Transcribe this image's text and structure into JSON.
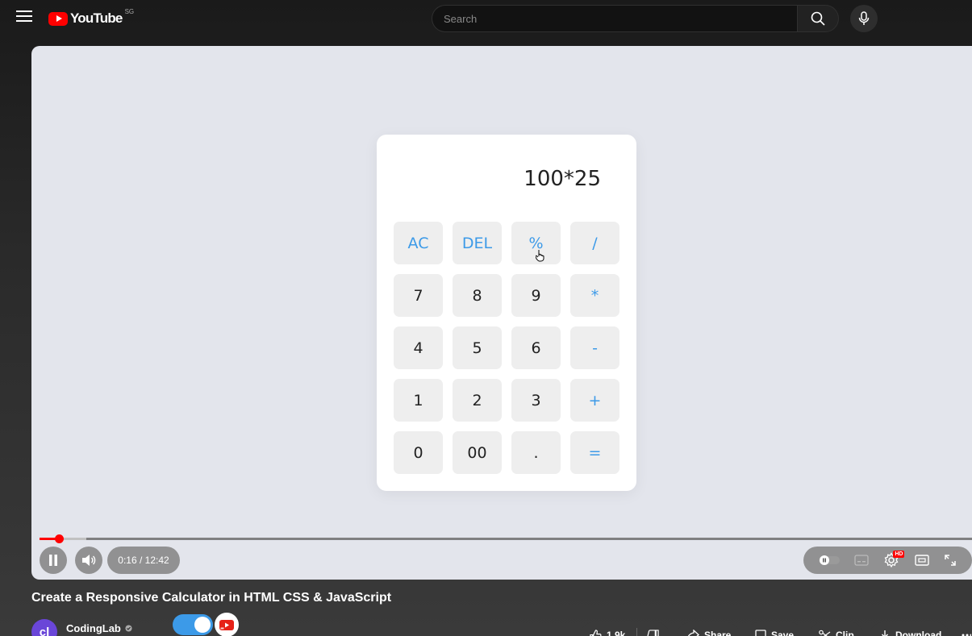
{
  "topbar": {
    "logo_text": "YouTube",
    "region": "SG",
    "search_placeholder": "Search"
  },
  "calculator": {
    "display": "100*25",
    "keys": [
      {
        "label": "AC",
        "kind": "op"
      },
      {
        "label": "DEL",
        "kind": "op"
      },
      {
        "label": "%",
        "kind": "op"
      },
      {
        "label": "/",
        "kind": "op"
      },
      {
        "label": "7",
        "kind": "num"
      },
      {
        "label": "8",
        "kind": "num"
      },
      {
        "label": "9",
        "kind": "num"
      },
      {
        "label": "*",
        "kind": "op"
      },
      {
        "label": "4",
        "kind": "num"
      },
      {
        "label": "5",
        "kind": "num"
      },
      {
        "label": "6",
        "kind": "num"
      },
      {
        "label": "-",
        "kind": "op"
      },
      {
        "label": "1",
        "kind": "num"
      },
      {
        "label": "2",
        "kind": "num"
      },
      {
        "label": "3",
        "kind": "num"
      },
      {
        "label": "+",
        "kind": "op"
      },
      {
        "label": "0",
        "kind": "num"
      },
      {
        "label": "00",
        "kind": "num"
      },
      {
        "label": ".",
        "kind": "num"
      },
      {
        "label": "=",
        "kind": "op"
      }
    ],
    "accent_color": "#3c9ae8"
  },
  "player": {
    "time": "0:16 / 12:42",
    "played_fraction": 0.021,
    "buffered_fraction": 0.05,
    "progress_color": "#ff0000",
    "hd_badge": "HD"
  },
  "video": {
    "title": "Create a Responsive Calculator in HTML CSS & JavaScript",
    "channel": "CodingLab",
    "avatar_initials": "cl"
  },
  "actions": {
    "likes": "1.9k",
    "share": "Share",
    "save": "Save",
    "clip": "Clip",
    "download": "Download"
  }
}
